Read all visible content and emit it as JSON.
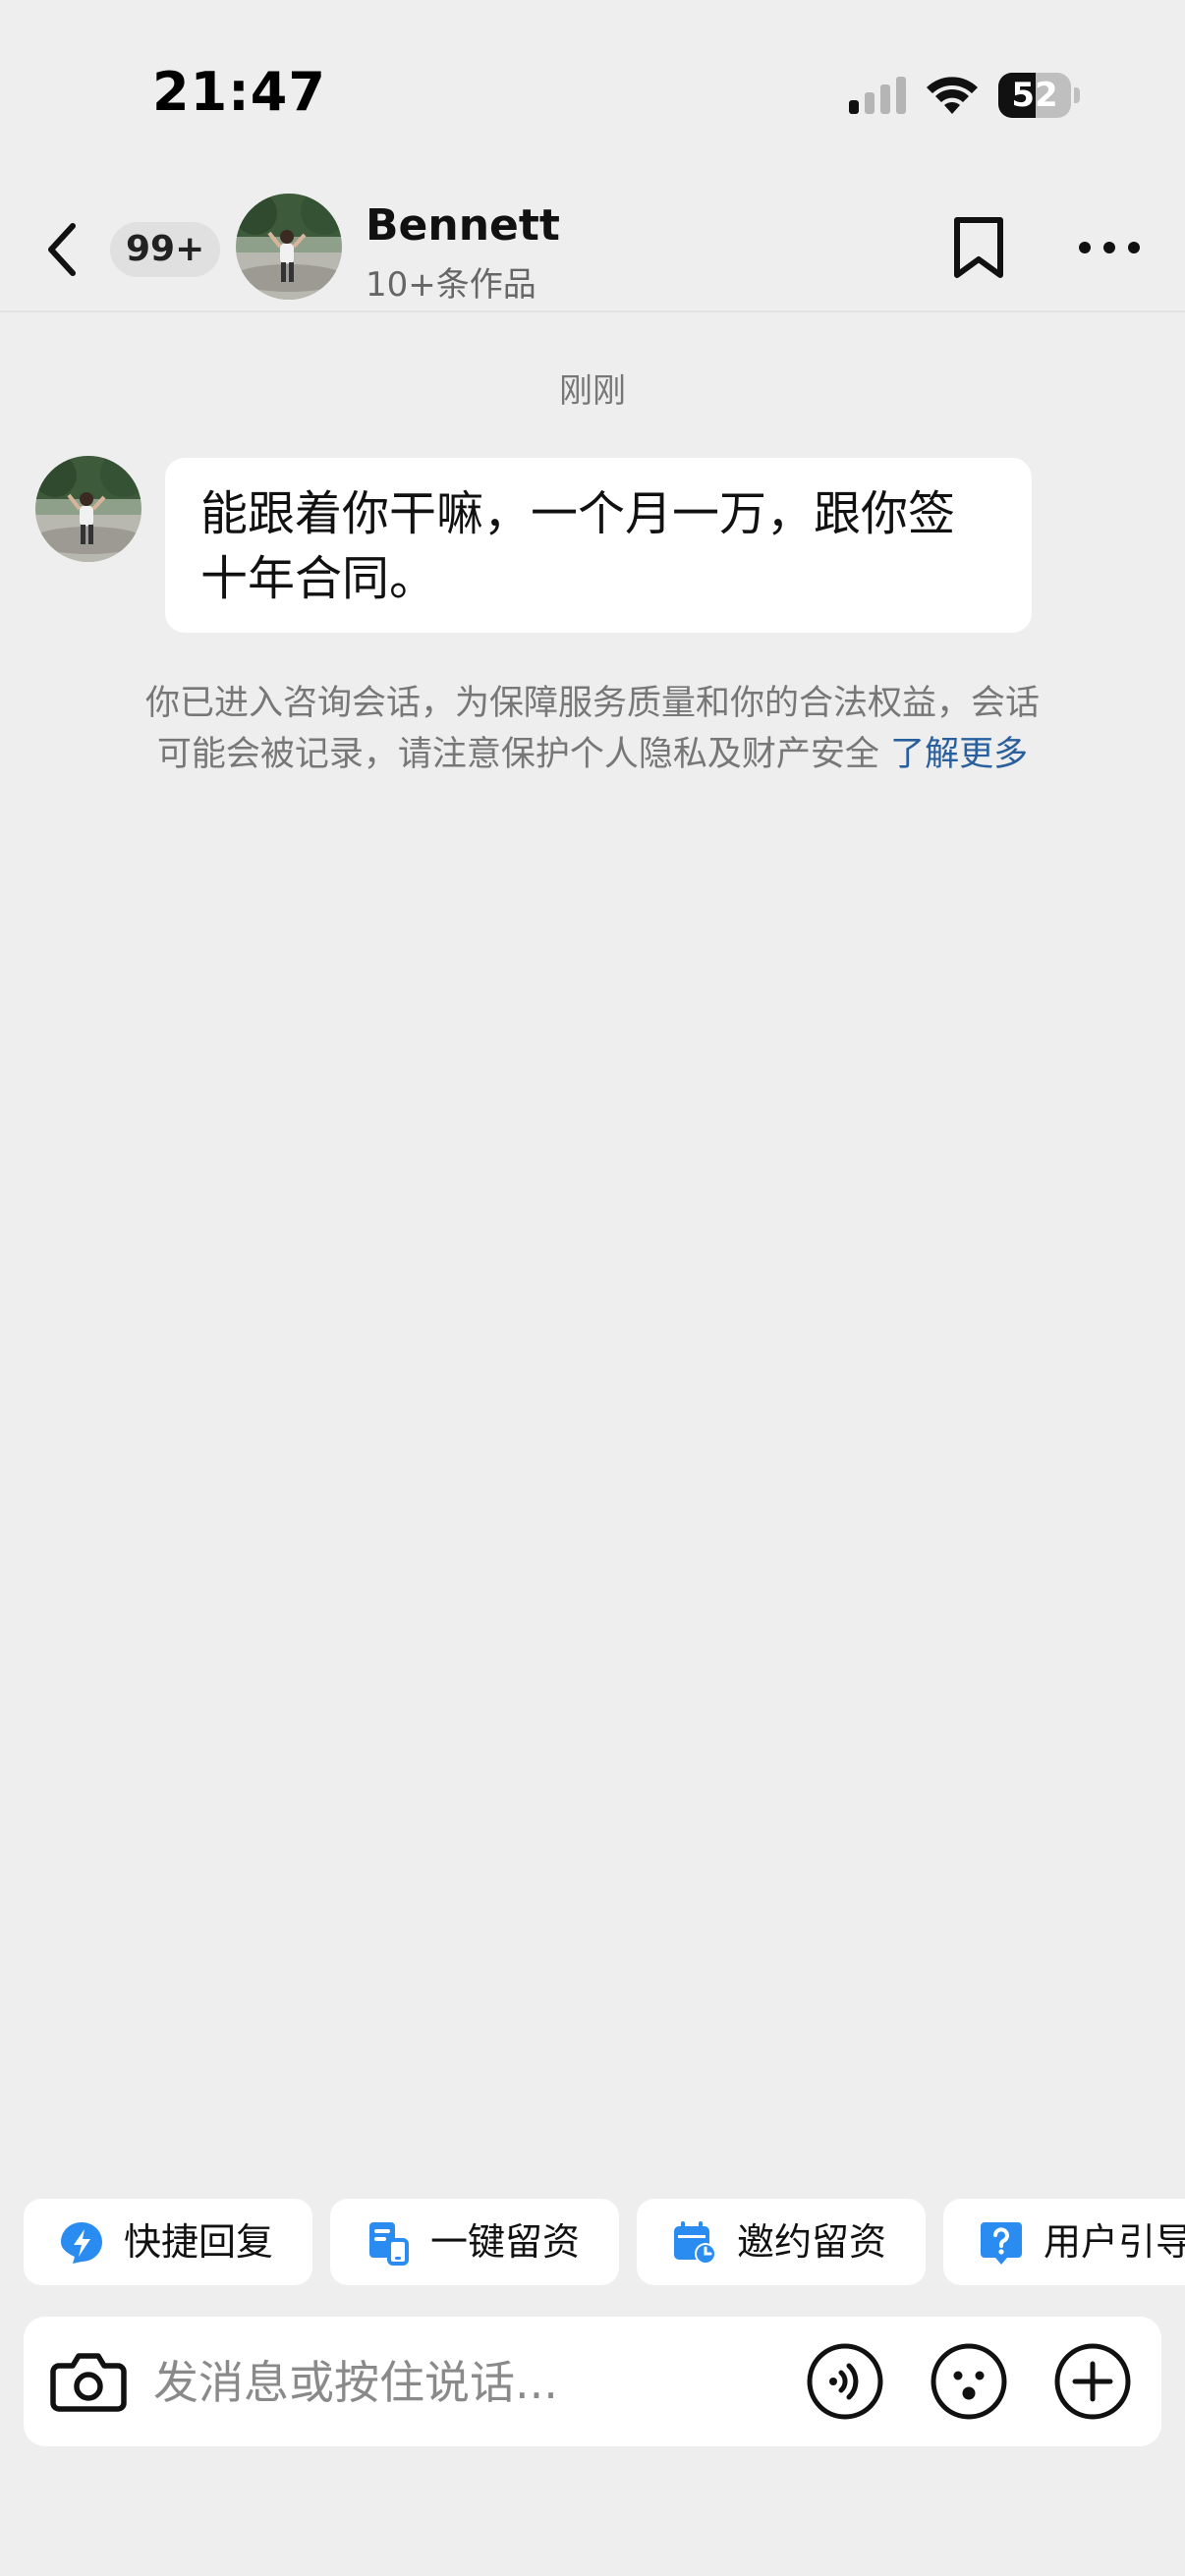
{
  "status_bar": {
    "time": "21:47",
    "battery": "52",
    "battery_level": 0.52
  },
  "header": {
    "unread_count": "99+",
    "name": "Bennett",
    "subtitle": "10+条作品"
  },
  "chat": {
    "timestamp": "刚刚",
    "messages": [
      {
        "sender": "Bennett",
        "text": "能跟着你干嘛，一个月一万，跟你签十年合同。"
      }
    ],
    "notice": {
      "text": "你已进入咨询会话，为保障服务质量和你的合法权益，会话可能会被记录，请注意保护个人隐私及财产安全",
      "link": "了解更多"
    }
  },
  "quick_actions": [
    {
      "label": "快捷回复",
      "icon": "lightning-icon"
    },
    {
      "label": "一键留资",
      "icon": "form-phone-icon"
    },
    {
      "label": "邀约留资",
      "icon": "calendar-clock-icon"
    },
    {
      "label": "用户引导",
      "icon": "question-icon"
    }
  ],
  "input": {
    "placeholder": "发消息或按住说话..."
  },
  "colors": {
    "background": "#eeeeee",
    "accent_blue": "#2a8cf0",
    "link": "#2a5f9e"
  }
}
